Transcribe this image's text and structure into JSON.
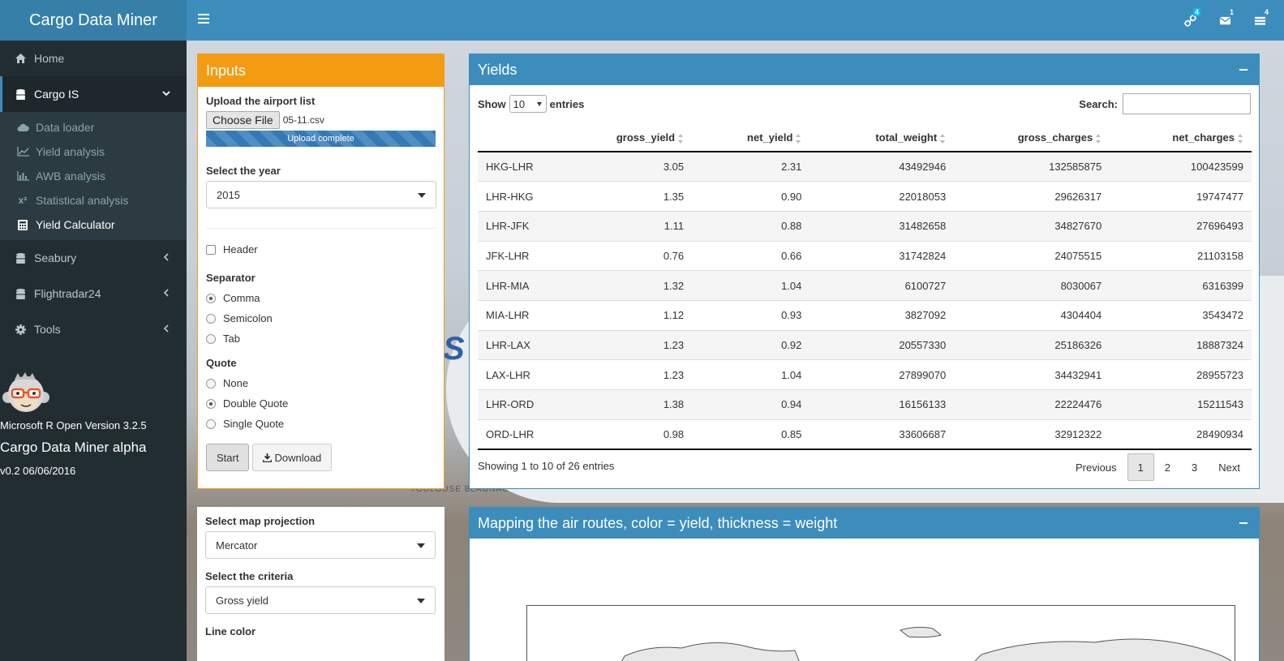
{
  "app": {
    "title": "Cargo Data Miner"
  },
  "navbar": {
    "badges": {
      "tasks": "4",
      "messages": "1",
      "notifications": "4"
    }
  },
  "sidebar": {
    "home": "Home",
    "cargo_is": "Cargo IS",
    "submenu": [
      {
        "label": "Data loader",
        "icon": "cloud-upload-icon"
      },
      {
        "label": "Yield analysis",
        "icon": "line-chart-icon"
      },
      {
        "label": "AWB analysis",
        "icon": "bar-chart-icon"
      },
      {
        "label": "Statistical analysis",
        "icon": "x-squared-icon"
      },
      {
        "label": "Yield Calculator",
        "icon": "calculator-icon"
      }
    ],
    "seabury": "Seabury",
    "flightradar": "Flightradar24",
    "tools": "Tools",
    "footer": {
      "version": "Microsoft R Open Version 3.2.5",
      "app_name": "Cargo Data Miner alpha",
      "release": "v0.2 06/06/2016"
    }
  },
  "background": {
    "sign": "TOULOUSE  BLAGNAC"
  },
  "inputs": {
    "title": "Inputs",
    "upload_label": "Upload the airport list",
    "choose_file": "Choose File",
    "file_name": "05-11.csv",
    "progress": "Upload complete",
    "progress_fraction": 1.0,
    "year_label": "Select the year",
    "year_value": "2015",
    "header_label": "Header",
    "separator_label": "Separator",
    "separators": [
      "Comma",
      "Semicolon",
      "Tab"
    ],
    "separator_selected": 0,
    "quote_label": "Quote",
    "quotes": [
      "None",
      "Double Quote",
      "Single Quote"
    ],
    "quote_selected": 1,
    "start": "Start",
    "download": "Download"
  },
  "yields": {
    "title": "Yields",
    "show": "Show",
    "length": "10",
    "entries": "entries",
    "search_label": "Search:",
    "columns": [
      "gross_yield",
      "net_yield",
      "total_weight",
      "gross_charges",
      "net_charges"
    ],
    "rows": [
      [
        "HKG-LHR",
        "3.05",
        "2.31",
        "43492946",
        "132585875",
        "100423599"
      ],
      [
        "LHR-HKG",
        "1.35",
        "0.90",
        "22018053",
        "29626317",
        "19747477"
      ],
      [
        "LHR-JFK",
        "1.11",
        "0.88",
        "31482658",
        "34827670",
        "27696493"
      ],
      [
        "JFK-LHR",
        "0.76",
        "0.66",
        "31742824",
        "24075515",
        "21103158"
      ],
      [
        "LHR-MIA",
        "1.32",
        "1.04",
        "6100727",
        "8030067",
        "6316399"
      ],
      [
        "MIA-LHR",
        "1.12",
        "0.93",
        "3827092",
        "4304404",
        "3543472"
      ],
      [
        "LHR-LAX",
        "1.23",
        "0.92",
        "20557330",
        "25186326",
        "18887324"
      ],
      [
        "LAX-LHR",
        "1.23",
        "1.04",
        "27899070",
        "34432941",
        "28955723"
      ],
      [
        "LHR-ORD",
        "1.38",
        "0.94",
        "16156133",
        "22224476",
        "15211543"
      ],
      [
        "ORD-LHR",
        "0.98",
        "0.85",
        "33606687",
        "32912322",
        "28490934"
      ]
    ],
    "info": "Showing 1 to 10 of 26 entries",
    "pager": {
      "prev": "Previous",
      "pages": [
        "1",
        "2",
        "3"
      ],
      "current": "1",
      "next": "Next"
    }
  },
  "map_controls": {
    "projection_label": "Select map projection",
    "projection_value": "Mercator",
    "criteria_label": "Select the criteria",
    "criteria_value": "Gross yield",
    "line_color_label": "Line color"
  },
  "map": {
    "title": "Mapping the air routes, color = yield, thickness = weight"
  }
}
